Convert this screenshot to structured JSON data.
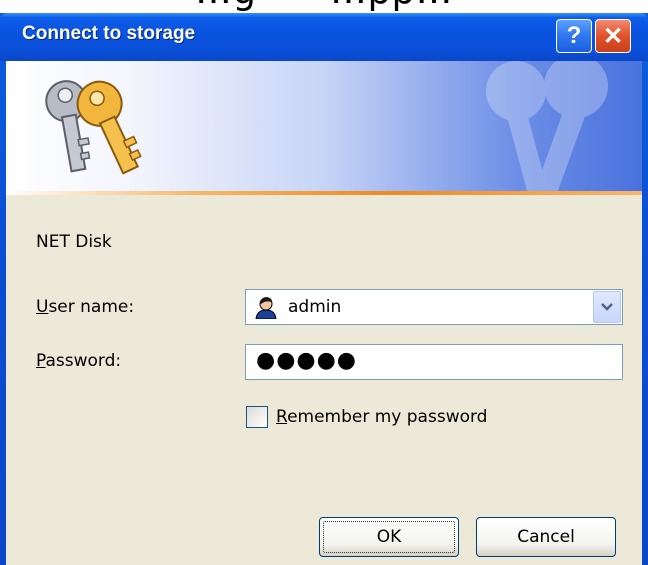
{
  "overflow_text": "…g      …pp…",
  "window": {
    "title": "Connect to storage",
    "help_label": "?",
    "close_label": "✕"
  },
  "banner": {
    "icon": "keys-icon"
  },
  "form": {
    "server_name": "NET Disk",
    "user_label_prefix": "U",
    "user_label_rest": "ser name:",
    "user_value": "admin",
    "user_icon": "user-icon",
    "password_label_prefix": "P",
    "password_label_rest": "assword:",
    "password_value": "●●●●●",
    "remember_label_prefix": "R",
    "remember_label_rest": "emember my password",
    "remember_checked": false
  },
  "buttons": {
    "ok": "OK",
    "cancel": "Cancel"
  },
  "colors": {
    "titlebar": "#0a52de",
    "client": "#ece9d8",
    "accent_orange": "#f08a1c"
  }
}
